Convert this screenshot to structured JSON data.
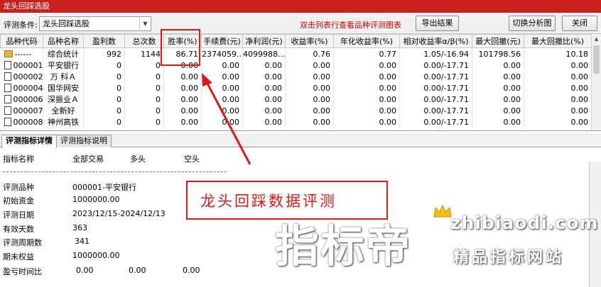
{
  "window": {
    "title": "龙头回踩选股"
  },
  "toolbar": {
    "condition_label": "评测条件:",
    "condition_value": "龙头回踩选股",
    "hint": "双击列表行查看品种评测图表",
    "export_label": "导出结果",
    "switch_label": "切换分析图",
    "close_label": "关闭"
  },
  "grid": {
    "columns": [
      "品种代码",
      "品种名称",
      "盈利数",
      "总次数",
      "胜率(%)",
      "手续费(元)",
      "净利润(元)",
      "收益率(%)",
      "年化收益率(%)",
      "相对收益率α/β(%)",
      "最大回撤(元)",
      "最大回撤比(%)"
    ],
    "rows": [
      {
        "code": "------",
        "name": "综合统计",
        "wins": "992",
        "total": "1144",
        "winrate": "86.71",
        "fee": "2374059....",
        "profit": "4099988...",
        "ret": "0.76",
        "annual": "0.77",
        "alpha": "1.05/-16.94",
        "maxdd": "101798.56",
        "maxddpct": "10.18",
        "summary": true
      },
      {
        "code": "000001",
        "name": "平安银行",
        "wins": "0",
        "total": "0",
        "winrate": "0.00",
        "fee": "0.00",
        "profit": "0.00",
        "ret": "0.00",
        "annual": "0.00",
        "alpha": "0.00/-17.71",
        "maxdd": "0.00",
        "maxddpct": "0.00"
      },
      {
        "code": "000002",
        "name": "万 科Ａ",
        "wins": "0",
        "total": "0",
        "winrate": "0.00",
        "fee": "0.00",
        "profit": "0.00",
        "ret": "0.00",
        "annual": "0.00",
        "alpha": "0.00/-17.71",
        "maxdd": "0.00",
        "maxddpct": "0.00"
      },
      {
        "code": "000004",
        "name": "国华网安",
        "wins": "0",
        "total": "0",
        "winrate": "0.00",
        "fee": "0.00",
        "profit": "0.00",
        "ret": "0.00",
        "annual": "0.00",
        "alpha": "0.00/-17.71",
        "maxdd": "0.00",
        "maxddpct": "0.00"
      },
      {
        "code": "000006",
        "name": "深振业Ａ",
        "wins": "0",
        "total": "0",
        "winrate": "0.00",
        "fee": "0.00",
        "profit": "0.00",
        "ret": "0.00",
        "annual": "0.00",
        "alpha": "0.00/-17.71",
        "maxdd": "0.00",
        "maxddpct": "0.00"
      },
      {
        "code": "000007",
        "name": "全新好",
        "wins": "0",
        "total": "0",
        "winrate": "0.00",
        "fee": "0.00",
        "profit": "0.00",
        "ret": "0.00",
        "annual": "0.00",
        "alpha": "0.00/-17.71",
        "maxdd": "0.00",
        "maxddpct": "0.00"
      },
      {
        "code": "000008",
        "name": "神州高铁",
        "wins": "0",
        "total": "0",
        "winrate": "0.00",
        "fee": "0.00",
        "profit": "0.00",
        "ret": "0.00",
        "annual": "0.00",
        "alpha": "0.00/-17.71",
        "maxdd": "0.00",
        "maxddpct": "0.00"
      }
    ]
  },
  "tabs": [
    {
      "label": "评测指标详情",
      "active": true
    },
    {
      "label": "评测指标说明",
      "active": false
    }
  ],
  "detail": {
    "headers": [
      "指标名称",
      "全部交易",
      "多头",
      "空头"
    ],
    "rows": [
      {
        "label": "评测品种",
        "value": "000001-平安银行"
      },
      {
        "label": "初始资金",
        "value": "1000000.00"
      },
      {
        "label": "评测日期",
        "value": "2023/12/15-2024/12/13"
      },
      {
        "label": "有效天数",
        "value": "363"
      },
      {
        "label": "评测周期数",
        "value": "341"
      },
      {
        "label": "期末权益",
        "value": "1000000.00"
      }
    ],
    "ratio": {
      "label": "盈亏时间比",
      "v1": "0.00",
      "v2": "0.00",
      "v3": "0.00"
    }
  },
  "annotation": {
    "callout": "龙头回踩数据评测"
  },
  "watermark": {
    "big": "指标帝",
    "url": "zhibiaodi.com",
    "sub": "精品指标网站"
  },
  "colors": {
    "title_bar": "#c8201e",
    "accent_red": "#e01818",
    "hint_red": "#d00000"
  }
}
